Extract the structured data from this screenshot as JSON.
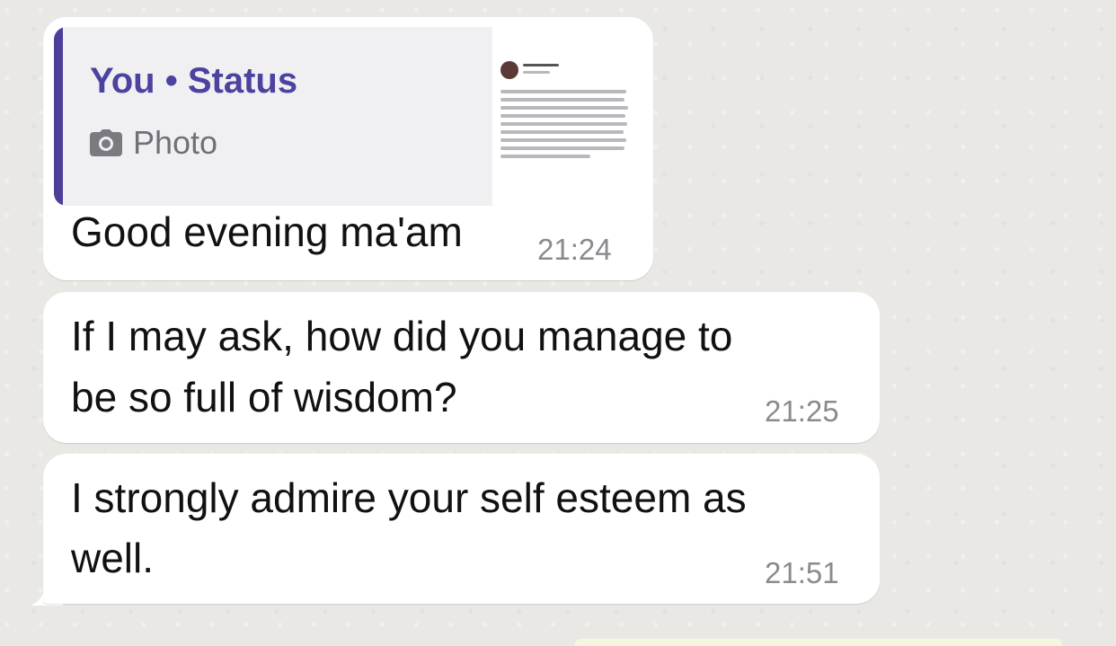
{
  "messages": [
    {
      "reply": {
        "sender": "You",
        "separator": "•",
        "context": "Status",
        "media_label": "Photo",
        "media_icon": "camera-icon"
      },
      "text": "Good evening ma'am",
      "time": "21:24"
    },
    {
      "text_lines": [
        "If I may ask, how did you manage to",
        "be so full of wisdom?"
      ],
      "time": "21:25"
    },
    {
      "text_lines": [
        "I strongly admire your self esteem as",
        "well."
      ],
      "time": "21:51"
    }
  ],
  "colors": {
    "chat_background": "#e9e8e4",
    "bubble": "#ffffff",
    "reply_accent": "#4b3f9a",
    "reply_title": "#4a43a0",
    "timestamp": "#8b8b8f"
  }
}
